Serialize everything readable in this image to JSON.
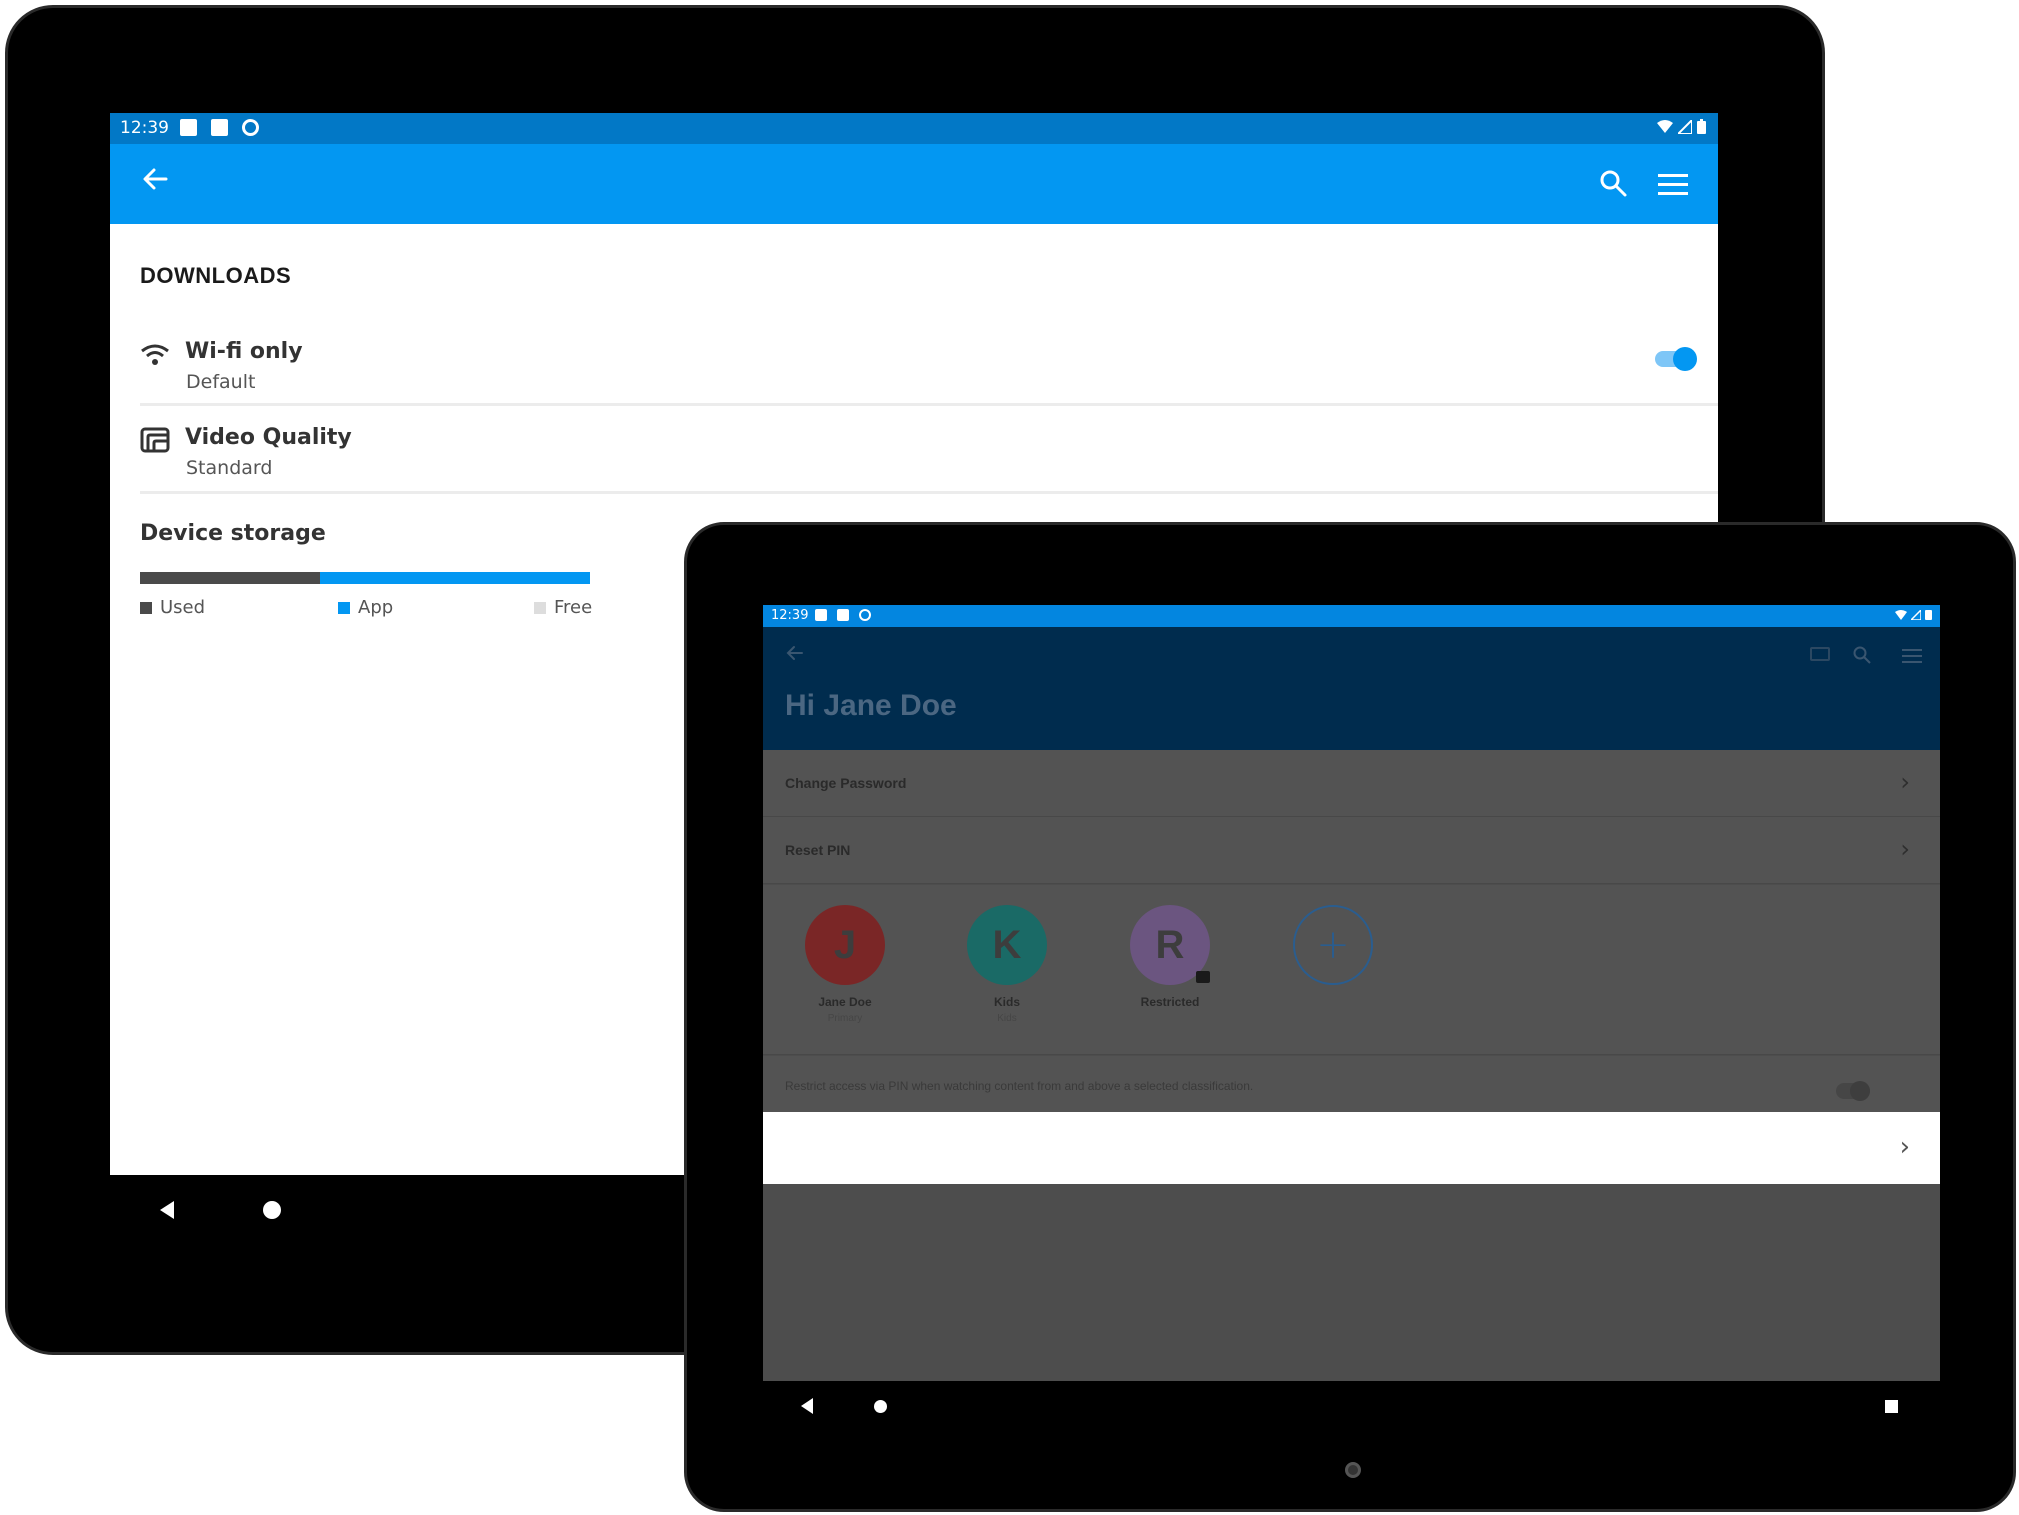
{
  "back_tablet": {
    "status_time": "12:39",
    "settings": {
      "section_title": "DOWNLOADS",
      "wifi": {
        "title": "Wi-fi only",
        "subtitle": "Default",
        "toggle_on": true
      },
      "video": {
        "title": "Video Quality",
        "subtitle": "Standard"
      },
      "storage": {
        "title": "Device storage",
        "legend": [
          "Used",
          "App",
          "Free"
        ]
      }
    },
    "colors": {
      "status": "#0278c6",
      "appbar": "#0397f2",
      "accent": "#0397f2"
    },
    "icons": [
      "back-arrow-icon",
      "search-icon",
      "menu-icon",
      "wifi-icon",
      "video-quality-icon"
    ]
  },
  "front_tablet": {
    "status_time": "12:39",
    "greeting": "Hi Jane Doe",
    "menu": [
      {
        "label": "Change Password"
      },
      {
        "label": "Reset PIN"
      }
    ],
    "profiles": [
      {
        "initial": "J",
        "name": "Jane Doe",
        "sub": "Primary",
        "color": "#7a2626"
      },
      {
        "initial": "K",
        "name": "Kids",
        "sub": "Kids",
        "color": "#1a6a66"
      },
      {
        "initial": "R",
        "name": "Restricted",
        "sub": "",
        "color": "#6b5580"
      }
    ],
    "restrict_text": "Restrict access via PIN when watching content from and above a selected classification.",
    "icons": [
      "back-arrow-icon",
      "cast-icon",
      "search-icon",
      "menu-icon",
      "chevron-right-icon",
      "add-profile-icon",
      "lock-icon"
    ]
  }
}
